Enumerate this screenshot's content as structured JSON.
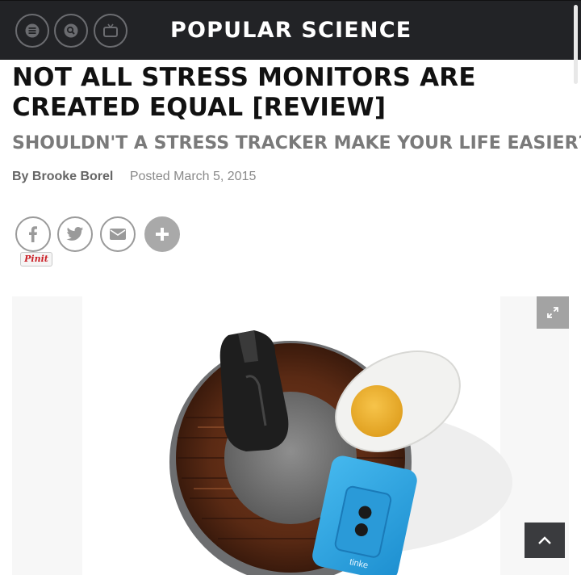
{
  "header": {
    "brand": "POPULAR SCIENCE",
    "buttons": [
      {
        "icon": "menu-icon"
      },
      {
        "icon": "search-icon"
      },
      {
        "icon": "tv-icon"
      }
    ],
    "background": "#222326"
  },
  "article": {
    "headline": "NOT ALL STRESS MONITORS ARE CREATED EQUAL [REVIEW]",
    "subhead": "SHOULDN'T A STRESS TRACKER MAKE YOUR LIFE EASIER?",
    "by_prefix": "By",
    "author": "Brooke Borel",
    "posted": "Posted March 5, 2015"
  },
  "share": {
    "buttons": [
      {
        "icon": "facebook-icon"
      },
      {
        "icon": "twitter-icon"
      },
      {
        "icon": "email-icon"
      },
      {
        "icon": "plus-icon"
      }
    ],
    "pinit_label": "Pinit"
  },
  "image": {
    "caption_text": "tinke",
    "expand_icon": "expand-icon",
    "back_to_top_icon": "chevron-up-icon"
  }
}
